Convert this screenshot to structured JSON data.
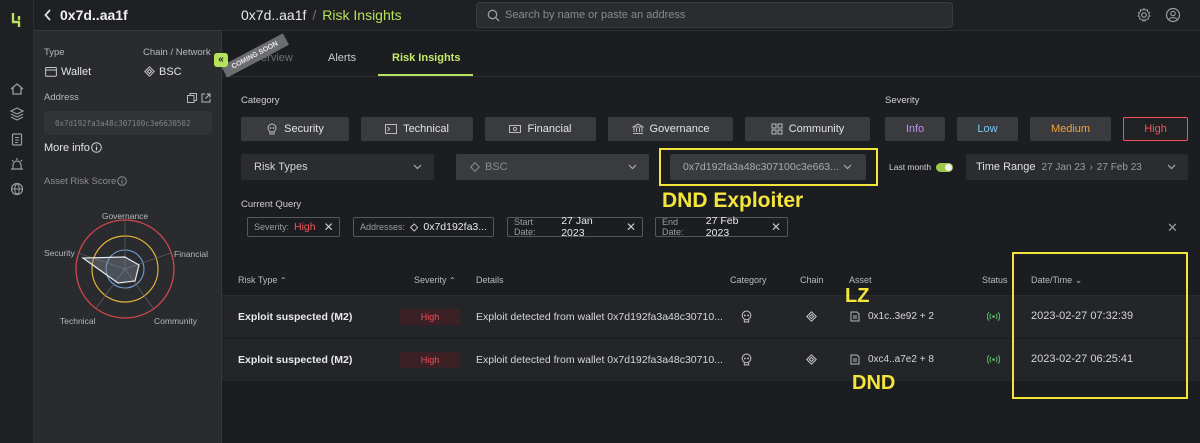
{
  "asset": {
    "short_address": "0x7d..aa1f",
    "type_label": "Type",
    "type_value": "Wallet",
    "chain_label": "Chain / Network",
    "chain_value": "BSC",
    "address_label": "Address",
    "full_address": "0x7d192fa3a48c307100c3e6630502",
    "more_info": "More info",
    "risk_score_label": "Asset Risk Score",
    "radar_axes": [
      "Governance",
      "Financial",
      "Community",
      "Technical",
      "Security"
    ]
  },
  "header": {
    "breadcrumb_root": "0x7d..aa1f",
    "breadcrumb_sep": "/",
    "breadcrumb_current": "Risk Insights",
    "search_placeholder": "Search by name or paste an address"
  },
  "tabs": {
    "overview": "Overview",
    "ribbon": "COMING SOON",
    "alerts": "Alerts",
    "risk_insights": "Risk Insights"
  },
  "filters": {
    "category_label": "Category",
    "categories": [
      "Security",
      "Technical",
      "Financial",
      "Governance",
      "Community"
    ],
    "severity_label": "Severity",
    "severities": [
      "Info",
      "Low",
      "Medium",
      "High"
    ],
    "severity_colors": {
      "info": "#c58cf0",
      "low": "#7cc6f0",
      "medium": "#f0a43c",
      "high": "#f2545b"
    },
    "risk_types": "Risk Types",
    "chain": "BSC",
    "address": "0x7d192fa3a48c307100c3e663...",
    "last_month": "Last month",
    "time_range_label": "Time Range",
    "time_range_from": "27 Jan 23",
    "time_range_to": "27 Feb 23"
  },
  "query": {
    "label": "Current Query",
    "severity_key": "Severity:",
    "severity_val": "High",
    "addresses_key": "Addresses:",
    "addresses_val": "0x7d192fa3...",
    "start_key": "Start Date:",
    "start_val": "27 Jan 2023",
    "end_key": "End Date:",
    "end_val": "27 Feb 2023"
  },
  "table": {
    "columns": [
      "Risk Type",
      "Severity",
      "Details",
      "Category",
      "Chain",
      "Asset",
      "Status",
      "Date/Time"
    ],
    "rows": [
      {
        "risk_type": "Exploit suspected (M2)",
        "severity": "High",
        "details": "Exploit detected from wallet 0x7d192fa3a48c30710...",
        "asset": "0x1c..3e92 + 2",
        "datetime": "2023-02-27 07:32:39"
      },
      {
        "risk_type": "Exploit suspected (M2)",
        "severity": "High",
        "details": "Exploit detected from wallet 0x7d192fa3a48c30710...",
        "asset": "0xc4..a7e2 + 8",
        "datetime": "2023-02-27 06:25:41"
      }
    ]
  },
  "annotations": {
    "exploiter": "DND Exploiter",
    "lz": "LZ",
    "dnd": "DND"
  },
  "colors": {
    "accent": "#b6e15a",
    "high": "#f2545b",
    "annotation": "#f2e43a"
  }
}
